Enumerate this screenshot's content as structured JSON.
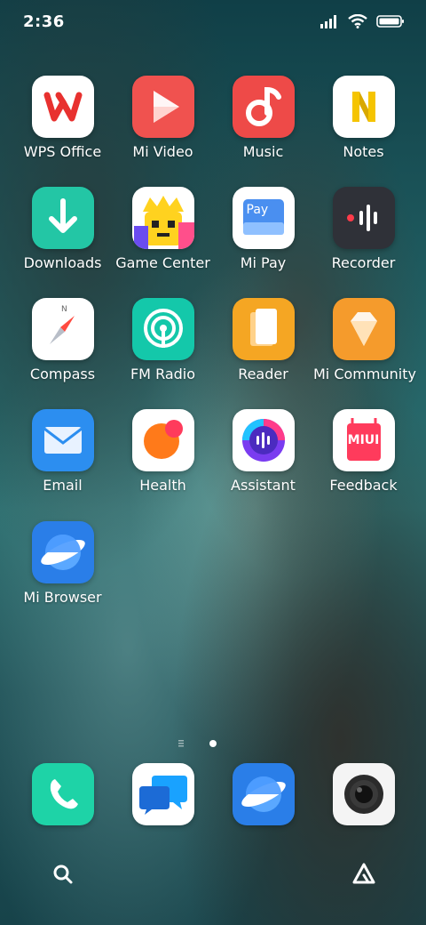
{
  "status_bar": {
    "time": "2:36",
    "icons": [
      "cellular-signal-icon",
      "wifi-icon",
      "battery-icon"
    ]
  },
  "apps": [
    {
      "label": "WPS Office",
      "icon": "wps-office-icon"
    },
    {
      "label": "Mi Video",
      "icon": "play-icon"
    },
    {
      "label": "Music",
      "icon": "music-note-icon"
    },
    {
      "label": "Notes",
      "icon": "notes-icon"
    },
    {
      "label": "Downloads",
      "icon": "download-arrow-icon"
    },
    {
      "label": "Game Center",
      "icon": "game-center-icon"
    },
    {
      "label": "Mi Pay",
      "icon": "pay-card-icon"
    },
    {
      "label": "Recorder",
      "icon": "recorder-waveform-icon"
    },
    {
      "label": "Compass",
      "icon": "compass-icon"
    },
    {
      "label": "FM Radio",
      "icon": "radio-icon"
    },
    {
      "label": "Reader",
      "icon": "book-icon"
    },
    {
      "label": "Mi Community",
      "icon": "diamond-icon"
    },
    {
      "label": "Email",
      "icon": "envelope-icon"
    },
    {
      "label": "Health",
      "icon": "health-icon"
    },
    {
      "label": "Assistant",
      "icon": "assistant-icon"
    },
    {
      "label": "Feedback",
      "icon": "miui-feedback-icon"
    },
    {
      "label": "Mi Browser",
      "icon": "browser-icon"
    }
  ],
  "pay_text": "Pay",
  "miui_text": "MIUI",
  "page_indicator": {
    "pages": 1,
    "current": 1
  },
  "dock": [
    {
      "name": "Phone",
      "icon": "phone-icon"
    },
    {
      "name": "Messages",
      "icon": "messages-icon"
    },
    {
      "name": "Browser",
      "icon": "browser-icon"
    },
    {
      "name": "Camera",
      "icon": "camera-icon"
    }
  ],
  "bottom_bar": [
    "search-icon",
    "app-vault-icon"
  ],
  "colors": {
    "wps_red": "#e8312f",
    "video_red": "#f0524f",
    "music_red": "#ee4a48",
    "notes_yellow": "#f5c400",
    "downloads_teal": "#23c6a5",
    "recorder_dark": "#2f3138",
    "radio_teal": "#14c8aa",
    "reader_orange": "#f5a623",
    "community_orange": "#f59b2c",
    "email_blue": "#2c8ef0",
    "browser_blue": "#2a7ee8",
    "phone_teal": "#1ed3a7"
  }
}
